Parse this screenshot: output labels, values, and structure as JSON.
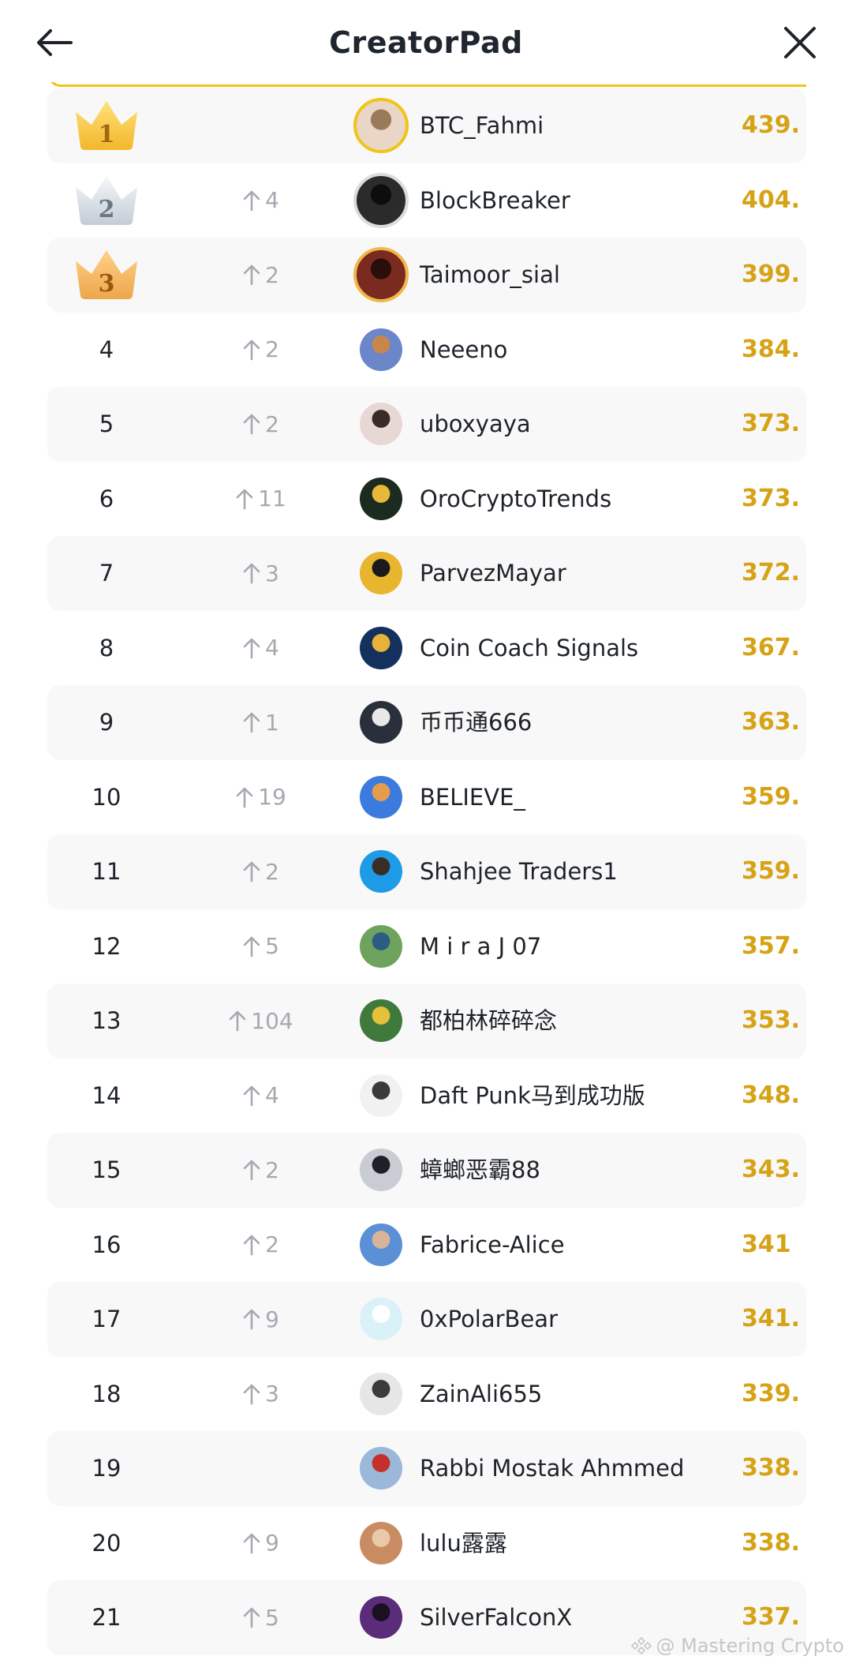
{
  "header": {
    "title": "CreatorPad"
  },
  "colors": {
    "score": "#d6a316",
    "gold_ring": "#f0c419",
    "change_up": "#a5a9b0"
  },
  "leaderboard": [
    {
      "rank": "1",
      "crown": "gold",
      "change": "",
      "name": "BTC_Fahmi",
      "score": "439.",
      "avatar": [
        "#e9d6c6",
        "#9b7a5b"
      ]
    },
    {
      "rank": "2",
      "crown": "silver",
      "change": "4",
      "name": "BlockBreaker",
      "score": "404.",
      "avatar": [
        "#2b2b2b",
        "#0d0d0d"
      ]
    },
    {
      "rank": "3",
      "crown": "bronze",
      "change": "2",
      "name": "Taimoor_sial",
      "score": "399.",
      "avatar": [
        "#7a2a1e",
        "#2a0e0b"
      ]
    },
    {
      "rank": "4",
      "crown": "",
      "change": "2",
      "name": "Neeeno",
      "score": "384.",
      "avatar": [
        "#6b86c9",
        "#c9864b"
      ]
    },
    {
      "rank": "5",
      "crown": "",
      "change": "2",
      "name": "uboxyaya",
      "score": "373.",
      "avatar": [
        "#e8d8d4",
        "#3a2a28"
      ]
    },
    {
      "rank": "6",
      "crown": "",
      "change": "11",
      "name": "OroCryptoTrends",
      "score": "373.",
      "avatar": [
        "#1b2b1f",
        "#e7b83a"
      ]
    },
    {
      "rank": "7",
      "crown": "",
      "change": "3",
      "name": "ParvezMayar",
      "score": "372.",
      "avatar": [
        "#e7b52e",
        "#1a1a1a"
      ]
    },
    {
      "rank": "8",
      "crown": "",
      "change": "4",
      "name": "Coin Coach Signals",
      "score": "367.",
      "avatar": [
        "#13315c",
        "#e8b23a"
      ]
    },
    {
      "rank": "9",
      "crown": "",
      "change": "1",
      "name": "币币通666",
      "score": "363.",
      "avatar": [
        "#2a2f3c",
        "#e8e8e8"
      ]
    },
    {
      "rank": "10",
      "crown": "",
      "change": "19",
      "name": "BELIEVE_",
      "score": "359.",
      "avatar": [
        "#3b7be0",
        "#e59d4b"
      ]
    },
    {
      "rank": "11",
      "crown": "",
      "change": "2",
      "name": "Shahjee Traders1",
      "score": "359.",
      "avatar": [
        "#1e9be6",
        "#3a2d24"
      ]
    },
    {
      "rank": "12",
      "crown": "",
      "change": "5",
      "name": "M i r a J 07",
      "score": "357.",
      "avatar": [
        "#6da35c",
        "#2d5c83"
      ]
    },
    {
      "rank": "13",
      "crown": "",
      "change": "104",
      "name": "都柏林碎碎念",
      "score": "353.",
      "avatar": [
        "#3f7a3c",
        "#e5c13a"
      ]
    },
    {
      "rank": "14",
      "crown": "",
      "change": "4",
      "name": "Daft Punk马到成功版",
      "score": "348.",
      "avatar": [
        "#f1f1f1",
        "#3a3a3a"
      ]
    },
    {
      "rank": "15",
      "crown": "",
      "change": "2",
      "name": "蟑螂恶霸88",
      "score": "343.",
      "avatar": [
        "#c9ccd2",
        "#1d2026"
      ]
    },
    {
      "rank": "16",
      "crown": "",
      "change": "2",
      "name": "Fabrice-Alice",
      "score": "341",
      "avatar": [
        "#5b8fd6",
        "#d7b49a"
      ]
    },
    {
      "rank": "17",
      "crown": "",
      "change": "9",
      "name": "0xPolarBear",
      "score": "341.",
      "avatar": [
        "#d9f1f7",
        "#ffffff"
      ]
    },
    {
      "rank": "18",
      "crown": "",
      "change": "3",
      "name": "ZainAli655",
      "score": "339.",
      "avatar": [
        "#e6e6e6",
        "#3b3b3b"
      ]
    },
    {
      "rank": "19",
      "crown": "",
      "change": "",
      "name": "Rabbi Mostak Ahmmed",
      "score": "338.",
      "avatar": [
        "#9bb8d9",
        "#c5302c"
      ]
    },
    {
      "rank": "20",
      "crown": "",
      "change": "9",
      "name": "lulu露露",
      "score": "338.",
      "avatar": [
        "#c98c62",
        "#e9c9a8"
      ]
    },
    {
      "rank": "21",
      "crown": "",
      "change": "5",
      "name": "SilverFalconX",
      "score": "337.",
      "avatar": [
        "#5a2c7a",
        "#1a1020"
      ]
    }
  ],
  "watermark": {
    "text": "@ Mastering Crypto"
  }
}
